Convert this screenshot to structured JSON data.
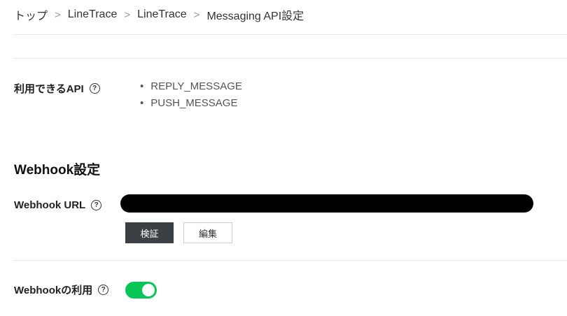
{
  "breadcrumb": {
    "items": [
      {
        "label": "トップ"
      },
      {
        "label": "LineTrace"
      },
      {
        "label": "LineTrace"
      },
      {
        "label": "Messaging API設定"
      }
    ],
    "separator": ">"
  },
  "available_api": {
    "label": "利用できるAPI",
    "help": "?",
    "items": [
      "REPLY_MESSAGE",
      "PUSH_MESSAGE"
    ]
  },
  "webhook": {
    "section_title": "Webhook設定",
    "url_label": "Webhook URL",
    "url_help": "?",
    "verify_button": "検証",
    "edit_button": "編集",
    "use_label": "Webhookの利用",
    "use_help": "?",
    "use_enabled": true
  },
  "colors": {
    "toggle_on": "#06c755",
    "primary_button": "#3b4045"
  }
}
